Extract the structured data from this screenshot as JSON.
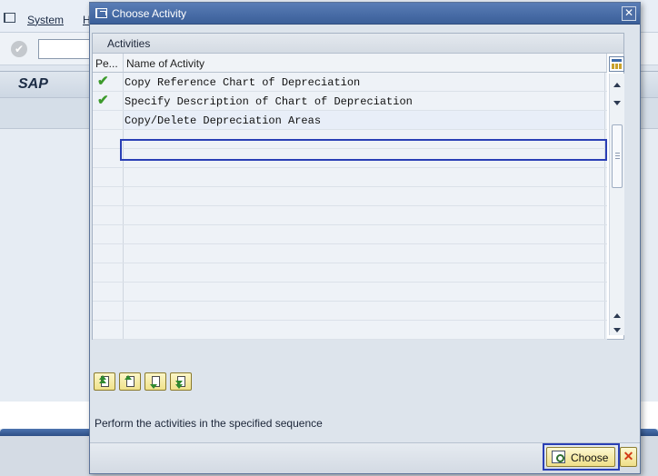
{
  "background": {
    "menu": [
      {
        "label": "System"
      },
      {
        "label": "H"
      }
    ],
    "sap_label": "SAP"
  },
  "dialog": {
    "title": "Choose Activity",
    "close_glyph": "✕",
    "panel_title": "Activities",
    "columns": [
      "Pe...",
      "Name of Activity"
    ],
    "rows": [
      {
        "done": true,
        "name": "Copy Reference Chart of Depreciation"
      },
      {
        "done": true,
        "name": "Specify Description of Chart of Depreciation"
      },
      {
        "done": false,
        "name": "Copy/Delete Depreciation Areas",
        "selected": true
      },
      {
        "done": false,
        "name": ""
      },
      {
        "done": false,
        "name": ""
      },
      {
        "done": false,
        "name": ""
      },
      {
        "done": false,
        "name": ""
      },
      {
        "done": false,
        "name": ""
      },
      {
        "done": false,
        "name": ""
      },
      {
        "done": false,
        "name": ""
      },
      {
        "done": false,
        "name": ""
      },
      {
        "done": false,
        "name": ""
      },
      {
        "done": false,
        "name": ""
      },
      {
        "done": false,
        "name": ""
      }
    ],
    "hint": "Perform the activities in the specified sequence",
    "choose_label": "Choose",
    "cancel_glyph": "✕",
    "icons": {
      "title": "window-menu-icon",
      "settings": "table-settings-icon",
      "nav": [
        "first-item-icon",
        "previous-item-icon",
        "next-item-icon",
        "last-item-icon"
      ],
      "choose": "choose-magnifier-icon",
      "cancel": "cancel-icon"
    },
    "colors": {
      "title_bar": "#3b5f99",
      "check": "#3c9a2b",
      "focus_frame": "#2a3fb5",
      "button": "#efdf88",
      "cancel": "#d23a16"
    }
  }
}
